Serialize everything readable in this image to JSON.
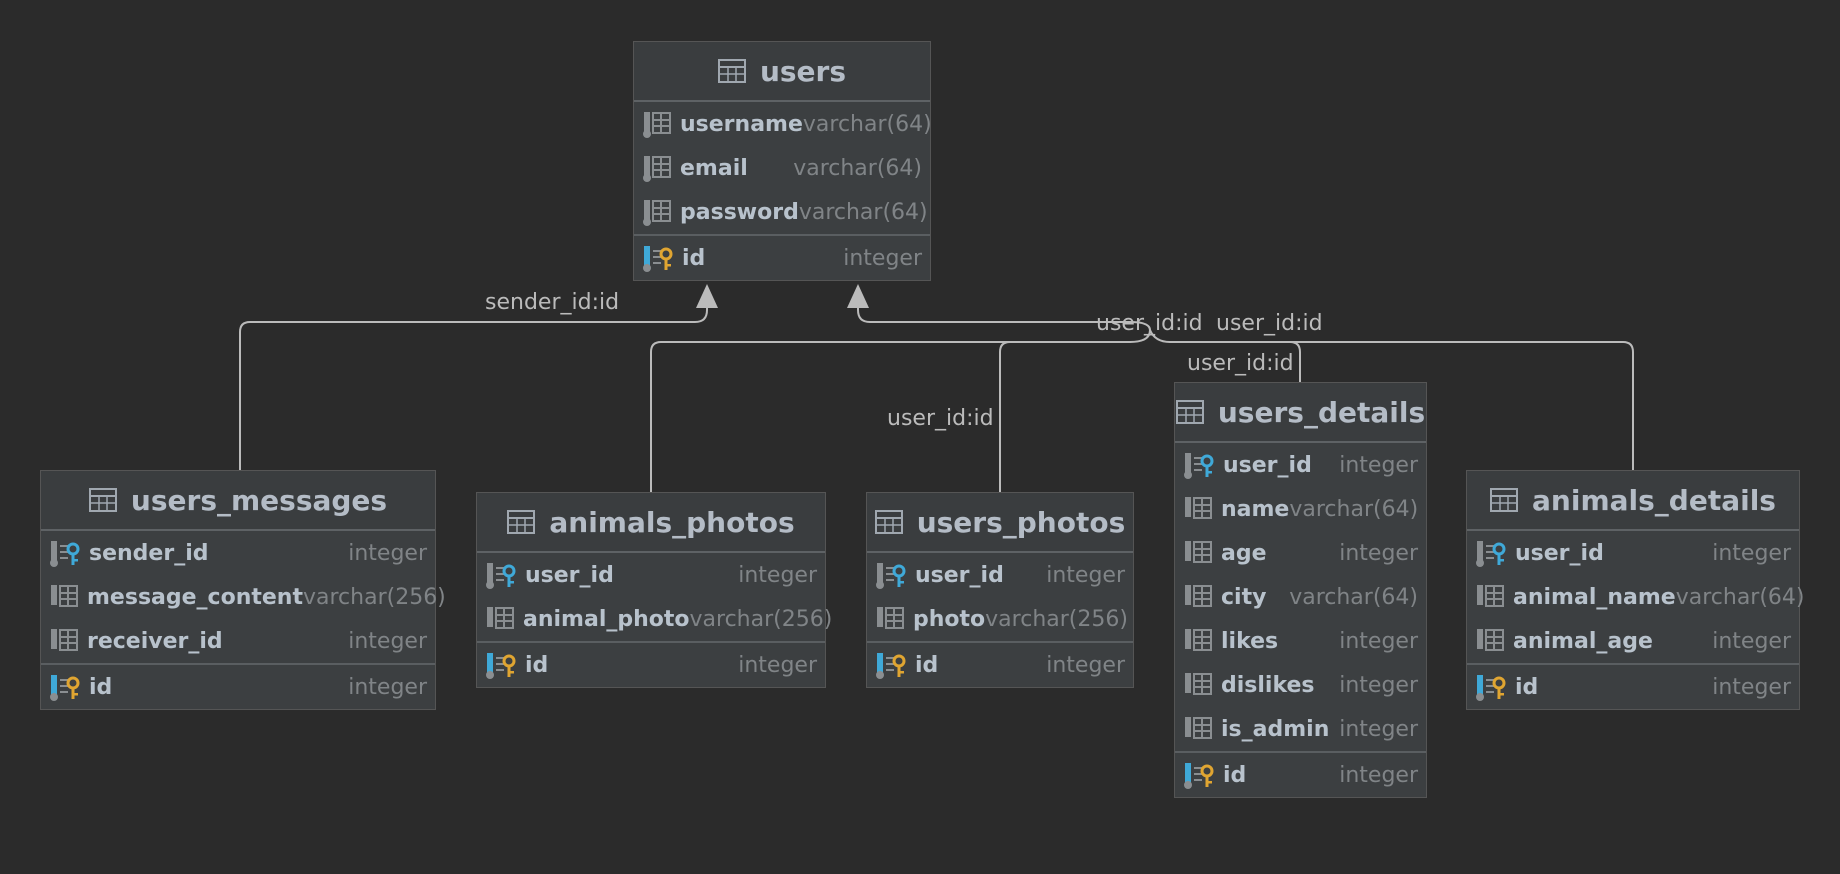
{
  "tables": {
    "users": {
      "name": "users",
      "columns": [
        {
          "name": "username",
          "type": "varchar(64)"
        },
        {
          "name": "email",
          "type": "varchar(64)"
        },
        {
          "name": "password",
          "type": "varchar(64)"
        }
      ],
      "pk": {
        "name": "id",
        "type": "integer"
      }
    },
    "users_messages": {
      "name": "users_messages",
      "columns": [
        {
          "name": "sender_id",
          "type": "integer",
          "fk": true
        },
        {
          "name": "message_content",
          "type": "varchar(256)"
        },
        {
          "name": "receiver_id",
          "type": "integer"
        }
      ],
      "pk": {
        "name": "id",
        "type": "integer"
      }
    },
    "animals_photos": {
      "name": "animals_photos",
      "columns": [
        {
          "name": "user_id",
          "type": "integer",
          "fk": true
        },
        {
          "name": "animal_photo",
          "type": "varchar(256)"
        }
      ],
      "pk": {
        "name": "id",
        "type": "integer"
      }
    },
    "users_photos": {
      "name": "users_photos",
      "columns": [
        {
          "name": "user_id",
          "type": "integer",
          "fk": true
        },
        {
          "name": "photo",
          "type": "varchar(256)"
        }
      ],
      "pk": {
        "name": "id",
        "type": "integer"
      }
    },
    "users_details": {
      "name": "users_details",
      "columns": [
        {
          "name": "user_id",
          "type": "integer",
          "fk": true
        },
        {
          "name": "name",
          "type": "varchar(64)"
        },
        {
          "name": "age",
          "type": "integer"
        },
        {
          "name": "city",
          "type": "varchar(64)"
        },
        {
          "name": "likes",
          "type": "integer"
        },
        {
          "name": "dislikes",
          "type": "integer"
        },
        {
          "name": "is_admin",
          "type": "integer"
        }
      ],
      "pk": {
        "name": "id",
        "type": "integer"
      }
    },
    "animals_details": {
      "name": "animals_details",
      "columns": [
        {
          "name": "user_id",
          "type": "integer",
          "fk": true
        },
        {
          "name": "animal_name",
          "type": "varchar(64)"
        },
        {
          "name": "animal_age",
          "type": "integer"
        }
      ],
      "pk": {
        "name": "id",
        "type": "integer"
      }
    }
  },
  "relations": {
    "messages_sender": "sender_id:id",
    "animals_photos_user": "user_id:id",
    "users_photos_user": "user_id:id",
    "users_details_user": "user_id:id",
    "animals_details_user": "user_id:id"
  },
  "colors": {
    "background": "#2b2b2b",
    "table_bg": "#3c3f41",
    "edge": "#bbbbbb",
    "pk_key": "#e0a531",
    "fk_key": "#3fa9d8",
    "icon_gray": "#8a8e91"
  }
}
